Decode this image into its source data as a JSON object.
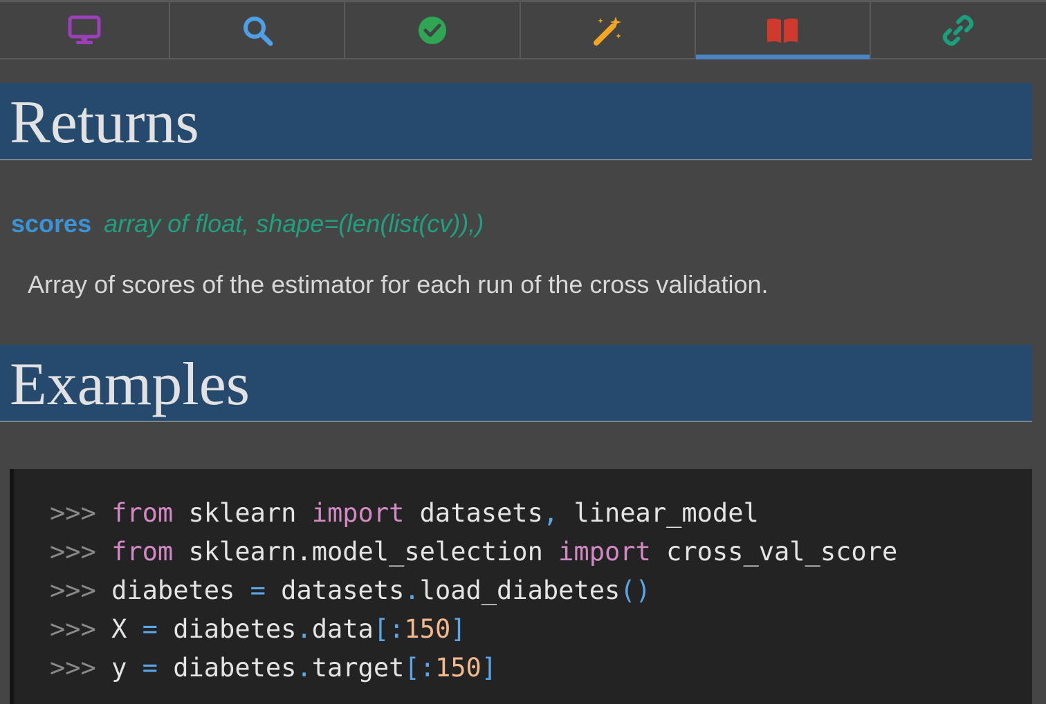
{
  "tabs": [
    {
      "icon": "monitor-icon",
      "color": "#9b40b8",
      "active": false
    },
    {
      "icon": "search-icon",
      "color": "#4ea0e6",
      "active": false
    },
    {
      "icon": "check-circle-icon",
      "color": "#2ea653",
      "active": false
    },
    {
      "icon": "magic-wand-icon",
      "color": "#f2a623",
      "active": false
    },
    {
      "icon": "book-icon",
      "color": "#cf3a2c",
      "active": true
    },
    {
      "icon": "link-icon",
      "color": "#19a07e",
      "active": false
    }
  ],
  "returns": {
    "heading": "Returns",
    "param_name": "scores",
    "param_type": "array of float, shape=(len(list(cv)),)",
    "description": "Array of scores of the estimator for each run of the cross validation."
  },
  "examples": {
    "heading": "Examples",
    "prompt": ">>>",
    "lines": [
      {
        "l1_kw": "from",
        "l1_a": "sklearn",
        "l1_kw2": "import",
        "l1_b": "datasets",
        "l1_op": ",",
        "l1_c": "linear_model"
      },
      {
        "l2_kw": "from",
        "l2_a": "sklearn.model_selection",
        "l2_kw2": "import",
        "l2_b": "cross_val_score"
      },
      {
        "l3_a": "diabetes",
        "l3_op": "=",
        "l3_b": "datasets",
        "l3_dot": ".",
        "l3_c": "load_diabetes",
        "l3_paren": "()"
      },
      {
        "l4_a": "X",
        "l4_op": "=",
        "l4_b": "diabetes",
        "l4_dot": ".",
        "l4_c": "data",
        "l4_br1": "[:",
        "l4_num": "150",
        "l4_br2": "]"
      },
      {
        "l5_a": "y",
        "l5_op": "=",
        "l5_b": "diabetes",
        "l5_dot": ".",
        "l5_c": "target",
        "l5_br1": "[:",
        "l5_num": "150",
        "l5_br2": "]"
      }
    ]
  }
}
